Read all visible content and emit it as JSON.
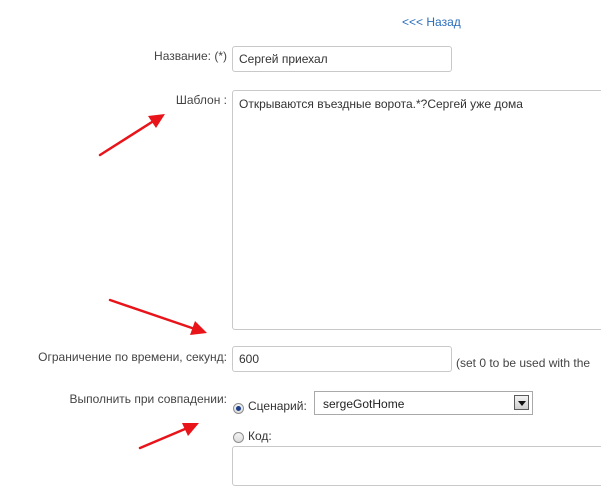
{
  "nav": {
    "back_label": "<<< Назад"
  },
  "form": {
    "name_label": "Название: (*)",
    "name_value": "Сергей приехал",
    "template_label": "Шаблон :",
    "template_value": "Открываются въездные ворота.*?Сергей уже дома",
    "timeout_label": "Ограничение по времени, секунд:",
    "timeout_value": "600",
    "timeout_hint": "(set 0 to be used with the",
    "execute_label": "Выполнить при совпадении:",
    "options": {
      "scenario_label": "Сценарий:",
      "scenario_selected": "sergeGotHome",
      "code_label": "Код:"
    }
  },
  "icons": {
    "arrow": "red-arrow-icon",
    "dropdown": "chevron-down-icon"
  },
  "colors": {
    "link": "#2a6ebb",
    "annotation_arrow": "#e8141a",
    "input_border": "#c9c9c9",
    "radio_selected": "#1c3f8a"
  }
}
